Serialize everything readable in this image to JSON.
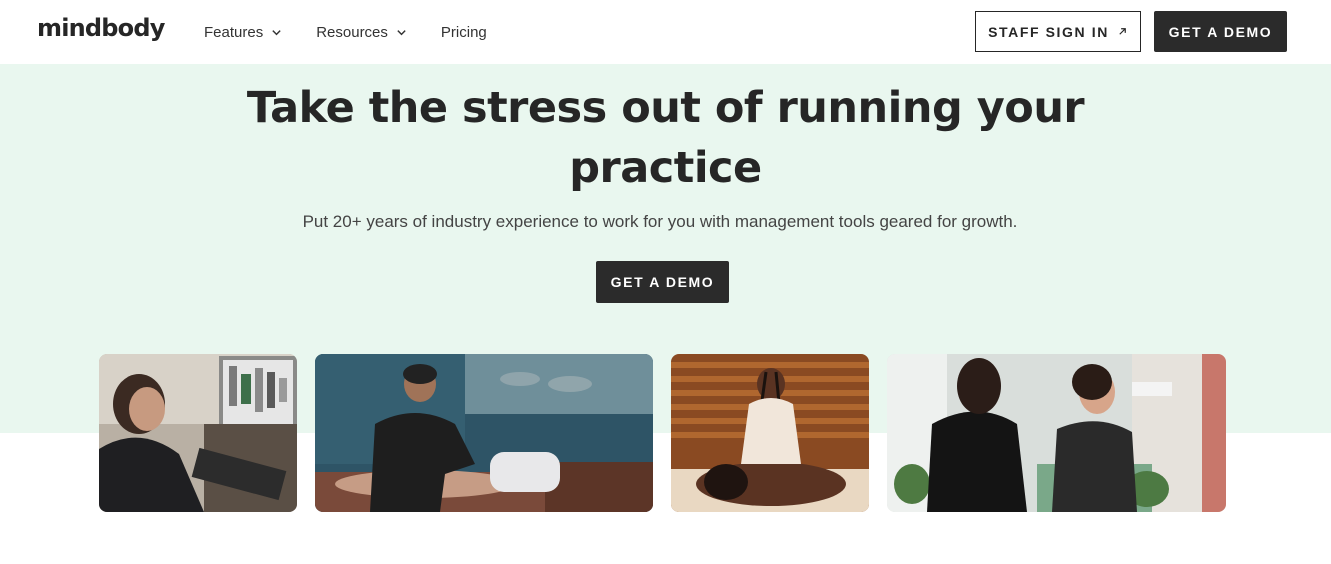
{
  "header": {
    "logo": "mindbody",
    "nav": [
      {
        "label": "Features",
        "has_dropdown": true
      },
      {
        "label": "Resources",
        "has_dropdown": true
      },
      {
        "label": "Pricing",
        "has_dropdown": false
      }
    ],
    "staff_sign_in": "STAFF SIGN IN",
    "get_demo": "GET A DEMO"
  },
  "hero": {
    "title_line1": "Take the stress out of running your",
    "title_line2": "practice",
    "subtitle": "Put 20+ years of industry experience to work for you with management tools geared for growth.",
    "cta": "GET A DEMO",
    "background": "#e9f7ef"
  },
  "images": [
    {
      "subject": "receptionist at front desk with headset"
    },
    {
      "subject": "massage therapist working on client"
    },
    {
      "subject": "therapist giving back massage in warm room"
    },
    {
      "subject": "two women talking at spa reception desk"
    }
  ],
  "colors": {
    "dark_button": "#2b2b2b",
    "hero_bg": "#e9f7ef",
    "text": "#262626"
  }
}
